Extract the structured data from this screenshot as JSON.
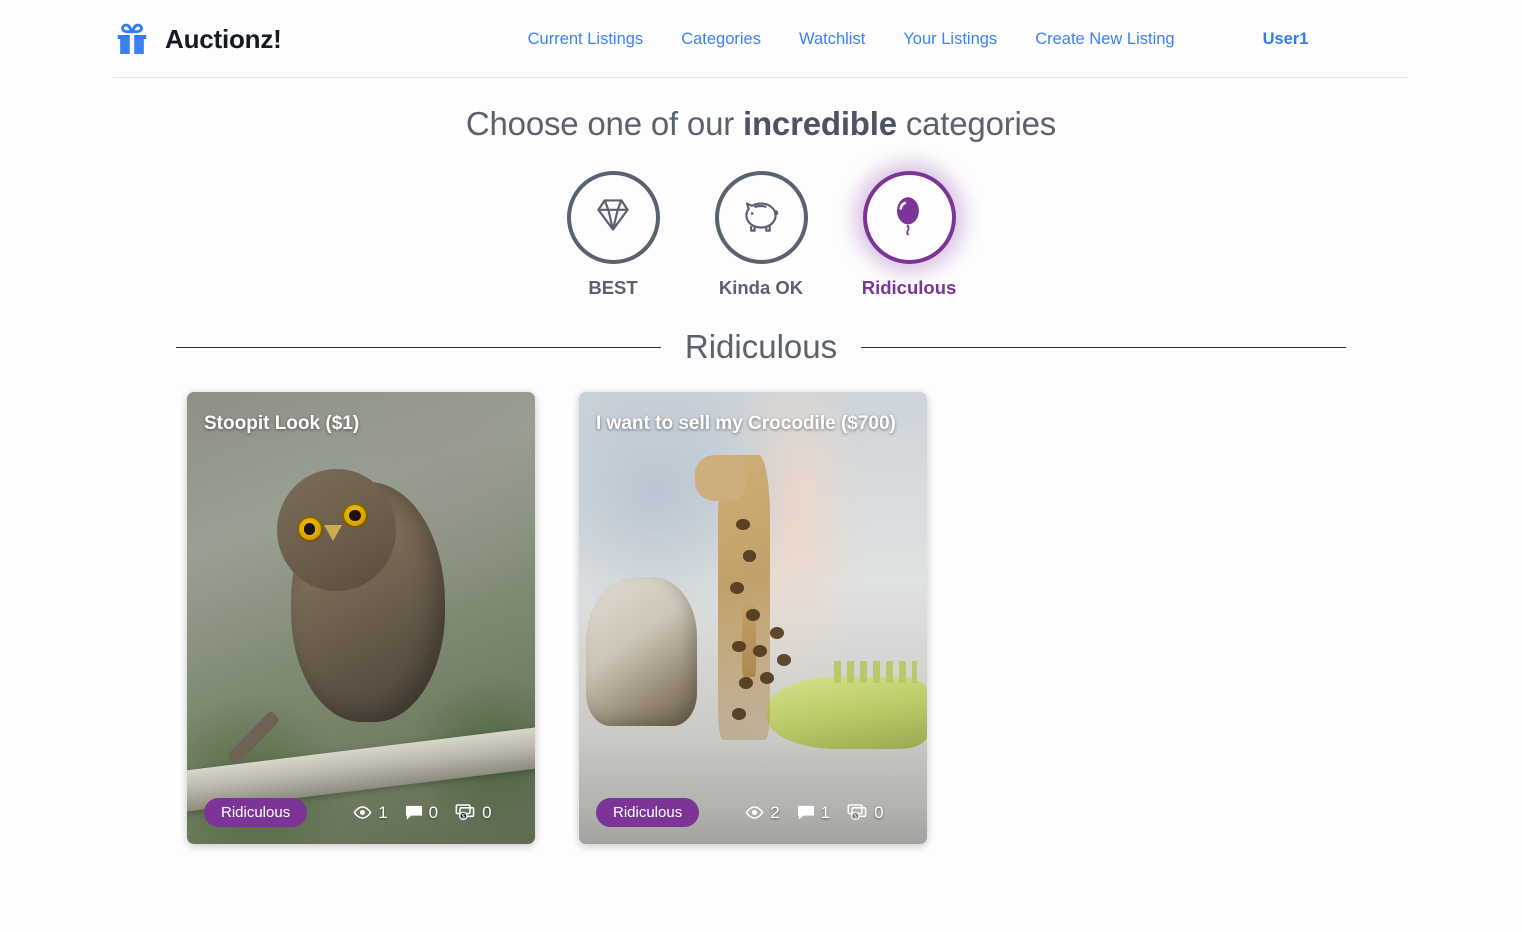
{
  "header": {
    "logo_icon": "gift-icon",
    "brand": "Auctionz!",
    "nav": [
      {
        "label": "Current Listings"
      },
      {
        "label": "Categories"
      },
      {
        "label": "Watchlist"
      },
      {
        "label": "Your Listings"
      },
      {
        "label": "Create New Listing"
      }
    ],
    "user": "User1"
  },
  "hero": {
    "heading_prefix": "Choose one of our ",
    "heading_emphasis": "incredible",
    "heading_suffix": " categories"
  },
  "categories": [
    {
      "label": "BEST",
      "icon": "diamond-icon",
      "active": false
    },
    {
      "label": "Kinda OK",
      "icon": "piggy-bank-icon",
      "active": false
    },
    {
      "label": "Ridiculous",
      "icon": "balloon-icon",
      "active": true
    }
  ],
  "section": {
    "title": "Ridiculous"
  },
  "listings": [
    {
      "title": "Stoopit Look ($1)",
      "badge": "Ridiculous",
      "views": "1",
      "comments": "0",
      "bids": "0",
      "image_alt": "owl perched on a branch"
    },
    {
      "title": "I want to sell my Crocodile ($700)",
      "badge": "Ridiculous",
      "views": "2",
      "comments": "1",
      "bids": "0",
      "image_alt": "wooden toy elephant, giraffe and crocodile"
    }
  ],
  "colors": {
    "brand_blue": "#3b82f6",
    "accent_purple": "#7c3596",
    "text_grey": "#5a6270",
    "page_bg": "#fdfdfd"
  }
}
